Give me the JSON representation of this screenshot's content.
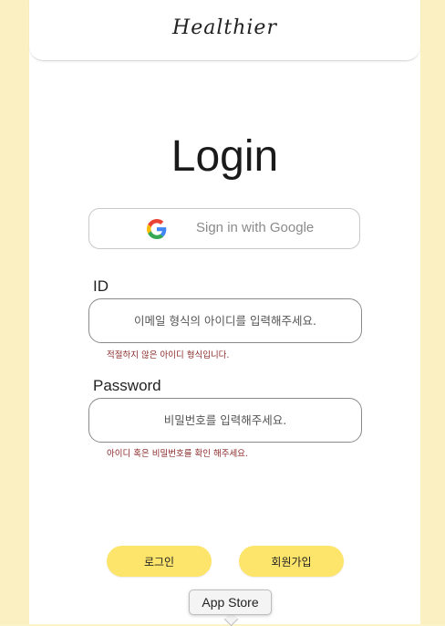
{
  "header": {
    "logo_text": "Healthier"
  },
  "main": {
    "title": "Login",
    "google_button": {
      "label": "Sign in with Google",
      "icon": "google-icon"
    },
    "id_field": {
      "label": "ID",
      "placeholder": "이메일 형식의 아이디를 입력해주세요.",
      "error": "적절하지 않은 아이디 형식입니다."
    },
    "password_field": {
      "label": "Password",
      "placeholder": "비밀번호를 입력해주세요.",
      "error": "아이디 혹은 비밀번호를 확인 해주세요."
    },
    "login_button": "로그인",
    "signup_button": "회원가입"
  },
  "tooltip": {
    "text": "App Store"
  },
  "colors": {
    "background": "#fdf3c8",
    "button": "#fde46a",
    "error": "#8b2a2a"
  }
}
